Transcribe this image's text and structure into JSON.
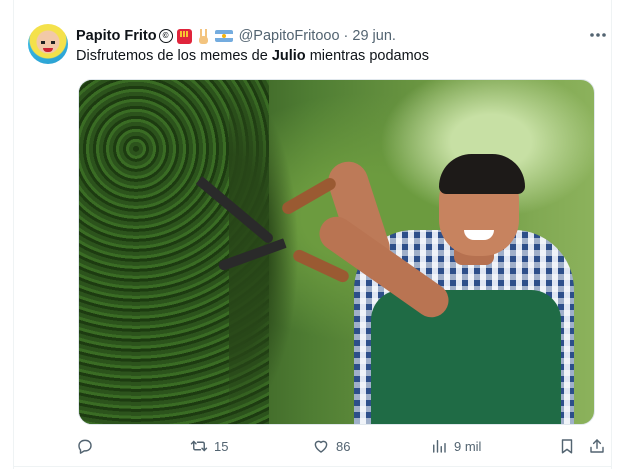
{
  "tweet": {
    "display_name": "Papito Frito",
    "copyright_mark": "©",
    "handle": "@PapitoFritooo",
    "separator": "·",
    "date": "29 jun.",
    "text_before": "Disfrutemos de los memes de ",
    "text_bold": "Julio",
    "text_after": " mientras podamos",
    "name_emojis": [
      "fries-emoji",
      "peace-hand-emoji",
      "argentina-flag-emoji"
    ]
  },
  "actions": {
    "reply_count": "",
    "retweet_count": "15",
    "like_count": "86",
    "views_count": "9 mil"
  },
  "icons": {
    "more": "more-horizontal-icon",
    "reply": "reply-icon",
    "retweet": "retweet-icon",
    "like": "heart-icon",
    "views": "views-chart-icon",
    "bookmark": "bookmark-icon",
    "share": "share-icon"
  },
  "colors": {
    "text": "#0f1419",
    "secondary": "#536471",
    "border": "#eff3f4"
  }
}
